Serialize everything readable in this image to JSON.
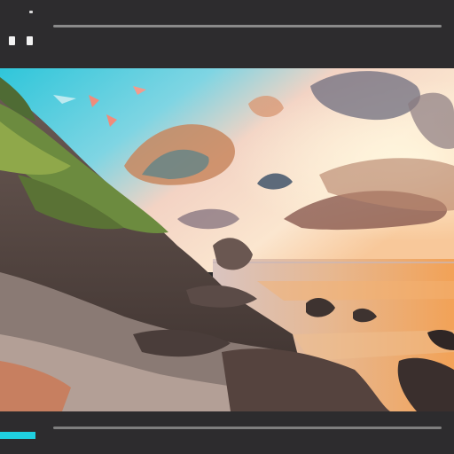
{
  "window": {
    "controls": [
      "menu-dot",
      "back-button",
      "forward-button"
    ]
  },
  "viewer": {
    "image": "coastal-sunset-photo"
  },
  "player": {
    "progress": 0.08
  },
  "colors": {
    "chrome": "#2d2c2e",
    "accent": "#1fd0e0",
    "line": "#8a8a8a"
  }
}
